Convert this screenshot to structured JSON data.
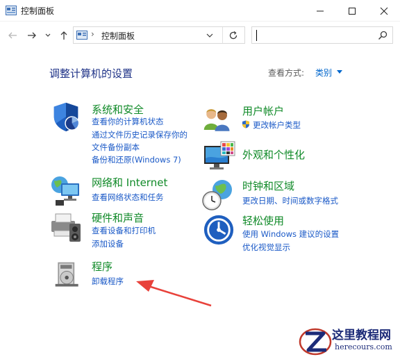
{
  "window": {
    "title": "控制面板",
    "minimize_icon": "minimize-icon",
    "maximize_icon": "maximize-icon",
    "close_icon": "close-icon"
  },
  "navigation": {
    "address_path": "控制面板",
    "address_separator": "›",
    "search_placeholder": "",
    "search_value": ""
  },
  "content": {
    "heading": "调整计算机的设置",
    "view_by_label": "查看方式:",
    "view_by_value": "类别"
  },
  "categories": {
    "system_security": {
      "title": "系统和安全",
      "icon": "shield-icon",
      "links": [
        "查看你的计算机状态",
        "通过文件历史记录保存你的",
        "文件备份副本",
        "备份和还原(Windows 7)"
      ]
    },
    "network": {
      "title": "网络和 Internet",
      "icon": "network-globe-icon",
      "links": [
        "查看网络状态和任务"
      ]
    },
    "hardware_sound": {
      "title": "硬件和声音",
      "icon": "printer-speaker-icon",
      "links": [
        "查看设备和打印机",
        "添加设备"
      ]
    },
    "programs": {
      "title": "程序",
      "icon": "programs-disc-icon",
      "links": [
        "卸载程序"
      ]
    },
    "user_accounts": {
      "title": "用户帐户",
      "icon": "users-icon",
      "links": [
        "更改帐户类型"
      ]
    },
    "appearance": {
      "title": "外观和个性化",
      "icon": "monitor-palette-icon",
      "links": []
    },
    "clock_region": {
      "title": "时钟和区域",
      "icon": "clock-globe-icon",
      "links": [
        "更改日期、时间或数字格式"
      ]
    },
    "ease_of_access": {
      "title": "轻松使用",
      "icon": "ease-of-access-icon",
      "links": [
        "使用 Windows 建议的设置",
        "优化视觉显示"
      ]
    }
  },
  "watermark": {
    "line1": "这里教程网",
    "line2": "herecours.com"
  },
  "colors": {
    "category_title": "#108a28",
    "link": "#1a59c7",
    "heading": "#1e3287",
    "annotation_arrow": "#e8413a"
  }
}
